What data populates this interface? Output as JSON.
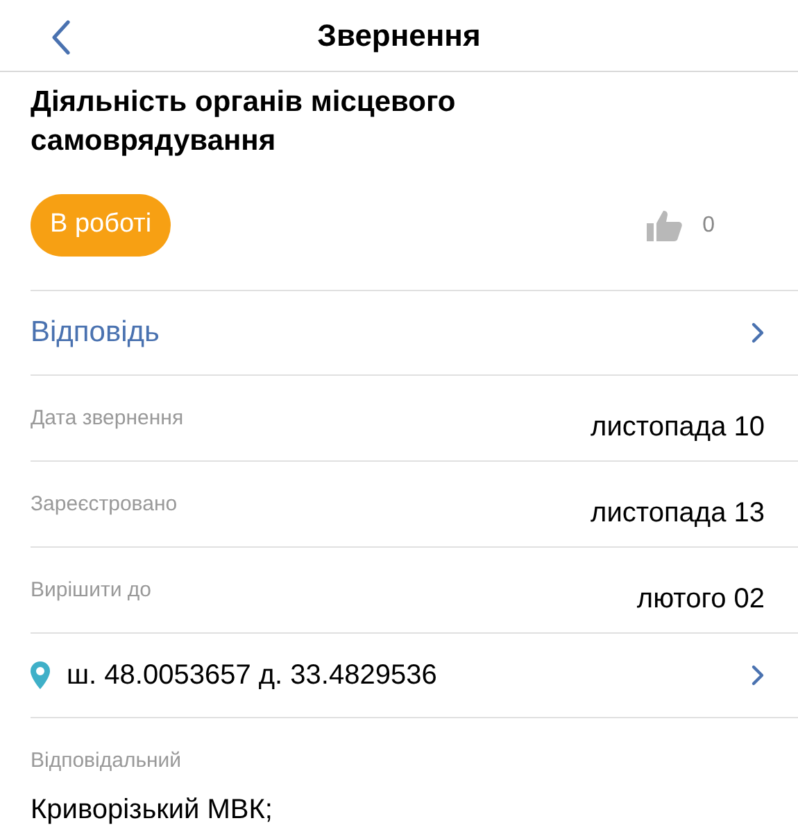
{
  "header": {
    "title": "Звернення"
  },
  "appeal": {
    "title": "Діяльність органів місцевого самоврядування",
    "status": {
      "label": "В роботі",
      "kind": "in_progress"
    },
    "likes": "0"
  },
  "answer_link": {
    "label": "Відповідь"
  },
  "details": [
    {
      "label": "Дата звернення",
      "value": "листопада 10"
    },
    {
      "label": "Зареєстровано",
      "value": "листопада 13"
    },
    {
      "label": "Вирішити до",
      "value": "лютого 02"
    }
  ],
  "location": {
    "text": "ш. 48.0053657 д. 33.4829536"
  },
  "responsible": {
    "label": "Відповідальний",
    "value": "Криворізький МВК;"
  }
}
